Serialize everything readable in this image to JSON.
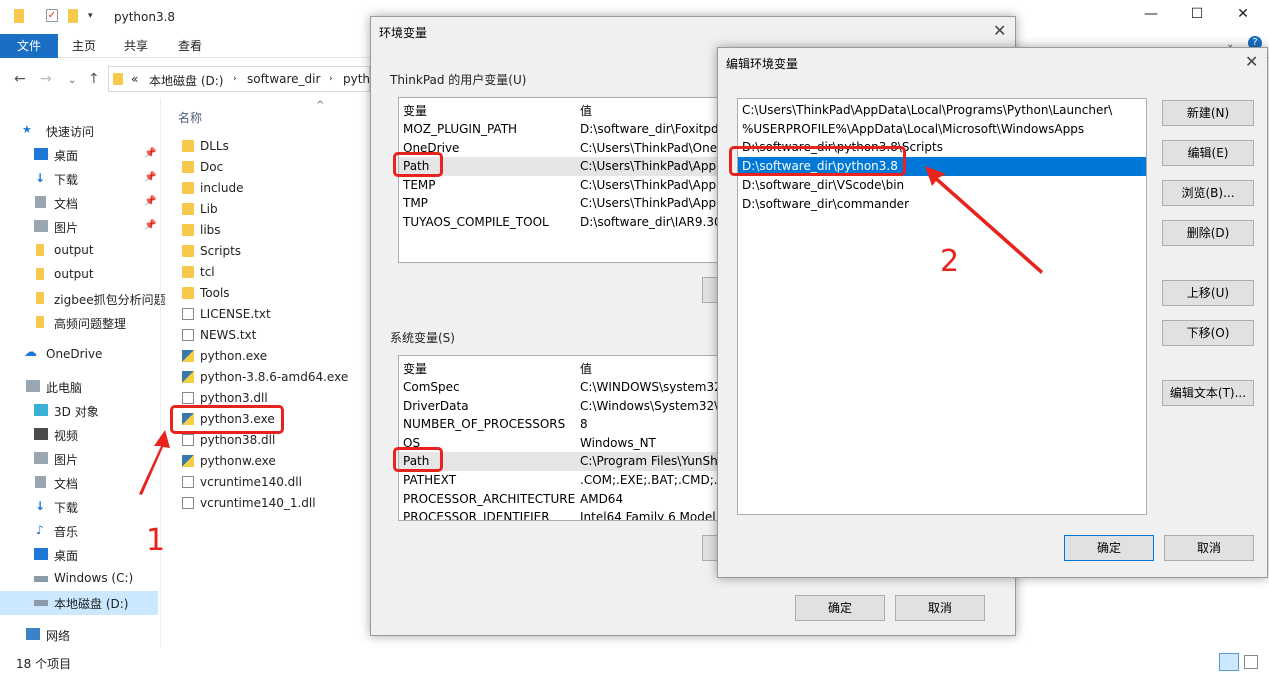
{
  "explorer": {
    "title": "python3.8",
    "ribbon_tabs": [
      "文件",
      "主页",
      "共享",
      "查看"
    ],
    "breadcrumb": {
      "prefix": "«",
      "drive": "本地磁盘 (D:)",
      "dir": "software_dir",
      "sub": "pytho"
    },
    "column_name": "名称",
    "nav_quick_access": "快速访问",
    "nav_items": [
      {
        "label": "桌面",
        "icon": "desktop-icon",
        "pinned": true
      },
      {
        "label": "下载",
        "icon": "download-icon",
        "pinned": true
      },
      {
        "label": "文档",
        "icon": "document-icon",
        "pinned": true
      },
      {
        "label": "图片",
        "icon": "picture-icon",
        "pinned": true
      },
      {
        "label": "output",
        "icon": "folder-icon",
        "pinned": false
      },
      {
        "label": "output",
        "icon": "folder-icon",
        "pinned": false
      },
      {
        "label": "zigbee抓包分析问题",
        "icon": "folder-icon",
        "pinned": false
      },
      {
        "label": "高频问题整理",
        "icon": "folder-icon",
        "pinned": false
      }
    ],
    "nav_onedrive": "OneDrive",
    "nav_thispc": "此电脑",
    "nav_pc_items": [
      "3D 对象",
      "视频",
      "图片",
      "文档",
      "下载",
      "音乐",
      "桌面",
      "Windows (C:)",
      "本地磁盘 (D:)"
    ],
    "nav_network": "网络",
    "files": [
      {
        "name": "DLLs",
        "type": "folder"
      },
      {
        "name": "Doc",
        "type": "folder"
      },
      {
        "name": "include",
        "type": "folder"
      },
      {
        "name": "Lib",
        "type": "folder"
      },
      {
        "name": "libs",
        "type": "folder"
      },
      {
        "name": "Scripts",
        "type": "folder"
      },
      {
        "name": "tcl",
        "type": "folder"
      },
      {
        "name": "Tools",
        "type": "folder"
      },
      {
        "name": "LICENSE.txt",
        "type": "file"
      },
      {
        "name": "NEWS.txt",
        "type": "file"
      },
      {
        "name": "python.exe",
        "type": "python"
      },
      {
        "name": "python-3.8.6-amd64.exe",
        "type": "python"
      },
      {
        "name": "python3.dll",
        "type": "file"
      },
      {
        "name": "python3.exe",
        "type": "python"
      },
      {
        "name": "python38.dll",
        "type": "file"
      },
      {
        "name": "pythonw.exe",
        "type": "python"
      },
      {
        "name": "vcruntime140.dll",
        "type": "file"
      },
      {
        "name": "vcruntime140_1.dll",
        "type": "file"
      }
    ],
    "status": "18 个项目"
  },
  "env_dialog": {
    "title": "环境变量",
    "user_group": "ThinkPad 的用户变量(U)",
    "col_var": "变量",
    "col_val": "值",
    "user_vars": [
      {
        "name": "MOZ_PLUGIN_PATH",
        "value": "D:\\software_dir\\Foxitpdf\\"
      },
      {
        "name": "OneDrive",
        "value": "C:\\Users\\ThinkPad\\OneD"
      },
      {
        "name": "Path",
        "value": "C:\\Users\\ThinkPad\\AppD"
      },
      {
        "name": "TEMP",
        "value": "C:\\Users\\ThinkPad\\AppD"
      },
      {
        "name": "TMP",
        "value": "C:\\Users\\ThinkPad\\AppD"
      },
      {
        "name": "TUYAOS_COMPILE_TOOL",
        "value": "D:\\software_dir\\IAR9.30\\"
      }
    ],
    "system_group": "系统变量(S)",
    "system_vars": [
      {
        "name": "ComSpec",
        "value": "C:\\WINDOWS\\system32"
      },
      {
        "name": "DriverData",
        "value": "C:\\Windows\\System32\\D"
      },
      {
        "name": "NUMBER_OF_PROCESSORS",
        "value": "8"
      },
      {
        "name": "OS",
        "value": "Windows_NT"
      },
      {
        "name": "Path",
        "value": "C:\\Program Files\\YunShu"
      },
      {
        "name": "PATHEXT",
        "value": ".COM;.EXE;.BAT;.CMD;.VB"
      },
      {
        "name": "PROCESSOR_ARCHITECTURE",
        "value": "AMD64"
      },
      {
        "name": "PROCESSOR_IDENTIFIER",
        "value": "Intel64 Family 6 Model 1"
      }
    ],
    "ok": "确定",
    "cancel": "取消"
  },
  "edit_dialog": {
    "title": "编辑环境变量",
    "entries": [
      "C:\\Users\\ThinkPad\\AppData\\Local\\Programs\\Python\\Launcher\\",
      "%USERPROFILE%\\AppData\\Local\\Microsoft\\WindowsApps",
      "D:\\software_dir\\python3.8\\Scripts",
      "D:\\software_dir\\python3.8",
      "D:\\software_dir\\VScode\\bin",
      "D:\\software_dir\\commander"
    ],
    "selected_index": 3,
    "buttons": [
      "新建(N)",
      "编辑(E)",
      "浏览(B)...",
      "删除(D)",
      "上移(U)",
      "下移(O)",
      "编辑文本(T)..."
    ],
    "ok": "确定",
    "cancel": "取消"
  },
  "annotations": {
    "step1": "1",
    "step2": "2",
    "color": "#e8231d"
  }
}
